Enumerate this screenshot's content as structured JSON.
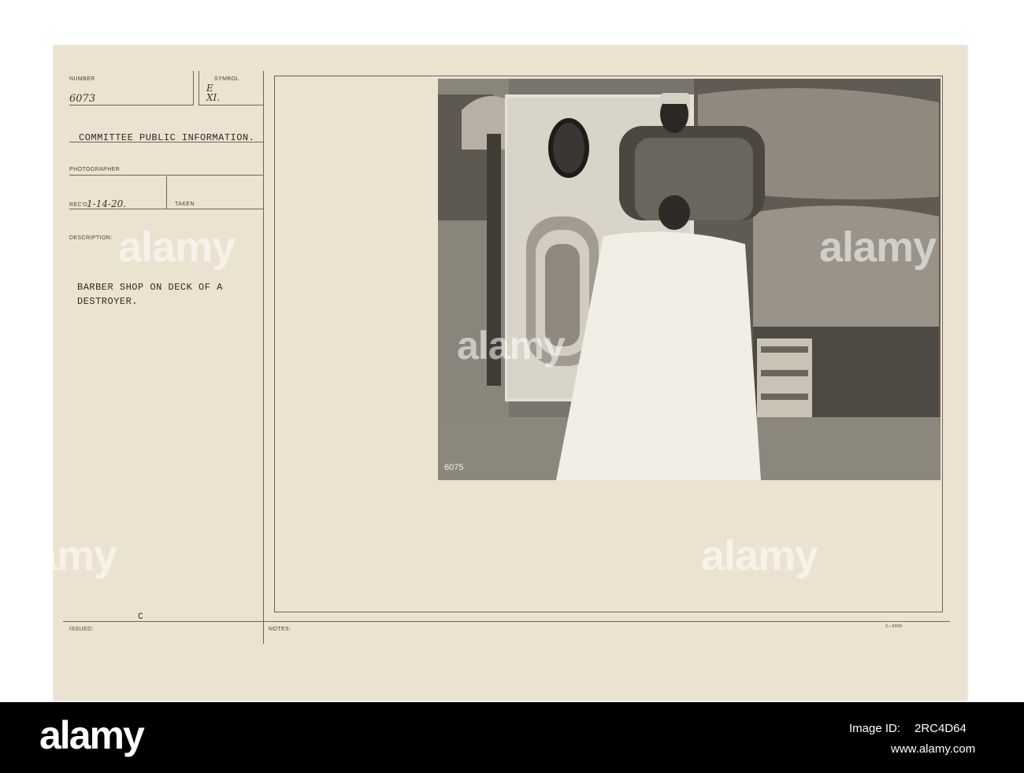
{
  "card": {
    "number_label": "NUMBER",
    "number_value": "6073",
    "symbol_label": "SYMBOL",
    "symbol_value": "E\nXI.",
    "agency": "COMMITTEE PUBLIC INFORMATION.",
    "photographer_label": "PHOTOGRAPHER",
    "recd_label": "REC'D",
    "recd_value": "1-14-20.",
    "taken_label": "TAKEN",
    "description_label": "DESCRIPTION:",
    "description_line1": "BARBER SHOP ON DECK OF A",
    "description_line2": "DESTROYER.",
    "issued_label": "ISSUED:",
    "issued_mark": "C",
    "notes_label": "NOTES:",
    "form_number": "3—5000",
    "photo_number": "6075"
  },
  "watermark": "alamy",
  "footer": {
    "brand": "alamy",
    "image_id_label": "Image ID:",
    "image_id": "2RC4D64",
    "site": "www.alamy.com"
  }
}
